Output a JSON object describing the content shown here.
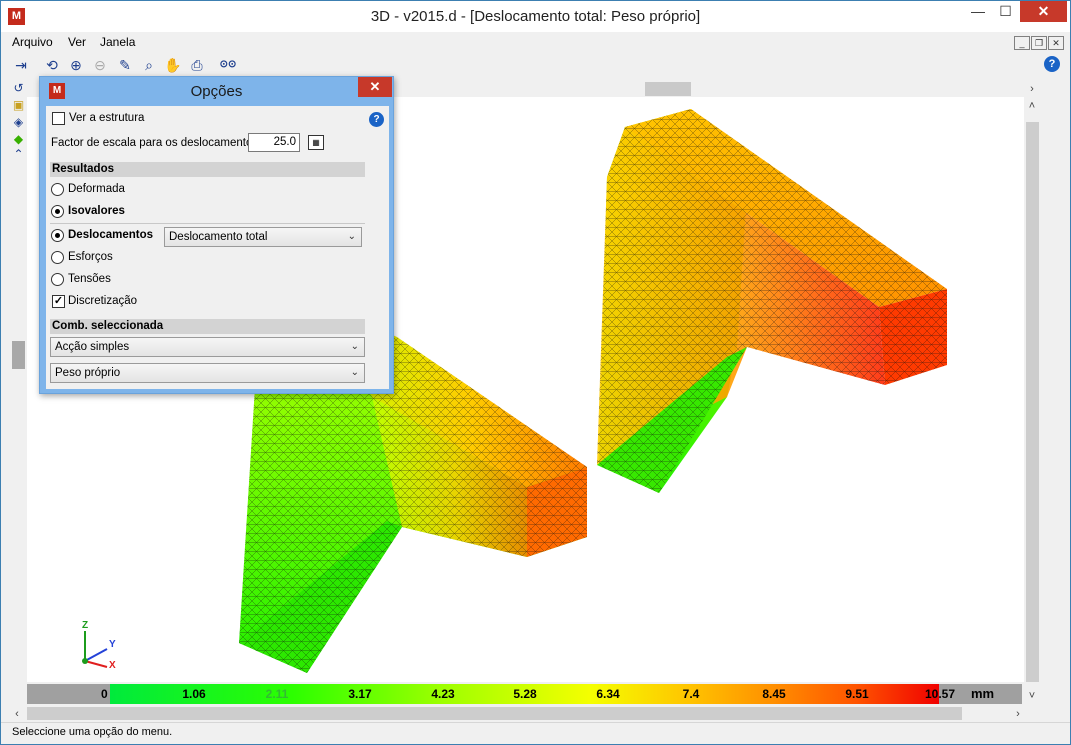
{
  "window": {
    "title": "3D - v2015.d - [Deslocamento total: Peso próprio]",
    "app_icon": "app-logo",
    "controls": {
      "minimize": "—",
      "maximize": "☐",
      "close": "✕"
    }
  },
  "menu": {
    "items": [
      {
        "label": "Arquivo"
      },
      {
        "label": "Ver"
      },
      {
        "label": "Janela"
      }
    ],
    "mdi_controls": {
      "minimize": "_",
      "restore": "❐",
      "close": "✕"
    }
  },
  "toolbar": {
    "buttons": [
      {
        "icon": "exit-icon",
        "glyph": "⇥"
      },
      {
        "icon": "rotate-view-icon",
        "glyph": "⟲"
      },
      {
        "icon": "zoom-window-icon",
        "glyph": "⊕"
      },
      {
        "icon": "zoom-out-icon",
        "glyph": "⊖"
      },
      {
        "icon": "pencil-icon",
        "glyph": "✎"
      },
      {
        "icon": "zoom-fit-icon",
        "glyph": "⌕"
      },
      {
        "icon": "pan-hand-icon",
        "glyph": "✋"
      },
      {
        "icon": "print-preview-icon",
        "glyph": "⎙"
      },
      {
        "icon": "binoculars-icon",
        "glyph": "⊙⊙"
      }
    ],
    "help_glyph": "?"
  },
  "left_tools": [
    {
      "icon": "rotate-icon",
      "glyph": "↺"
    },
    {
      "icon": "cube-icon",
      "glyph": "▣"
    },
    {
      "icon": "solid-icon",
      "glyph": "◈"
    },
    {
      "icon": "green-solid-icon",
      "glyph": "◆"
    },
    {
      "icon": "up-arrow-icon",
      "glyph": "⌃"
    }
  ],
  "dialog": {
    "title": "Opções",
    "close_glyph": "✕",
    "help_glyph": "?",
    "ver_estrutura": {
      "label": "Ver a estrutura",
      "checked": false
    },
    "scale_factor": {
      "label": "Factor de escala para os deslocamentos",
      "value": "25.0"
    },
    "resultados": {
      "header": "Resultados",
      "deformada": {
        "label": "Deformada",
        "selected": false
      },
      "isovalores": {
        "label": "Isovalores",
        "selected": true
      }
    },
    "tipo": {
      "deslocamentos": {
        "label": "Deslocamentos",
        "selected": true
      },
      "deslocamentos_select": "Deslocamento total",
      "esforcos": {
        "label": "Esforços",
        "selected": false
      },
      "tensoes": {
        "label": "Tensões",
        "selected": false
      },
      "discretizacao": {
        "label": "Discretização",
        "checked": true
      }
    },
    "comb": {
      "header": "Comb. seleccionada",
      "select1": "Acção simples",
      "select2": "Peso próprio"
    }
  },
  "legend": {
    "zero": "0",
    "values": [
      "1.06",
      "2.11",
      "3.17",
      "4.23",
      "5.28",
      "6.34",
      "7.4",
      "8.45",
      "9.51",
      "10.57"
    ],
    "unit": "mm",
    "colors": {
      "low": "#00ea3c",
      "mid": "#f5ff00",
      "high": "#f00000"
    }
  },
  "axes": {
    "z": "Z",
    "y": "Y",
    "x": "X"
  },
  "status": {
    "text": "Seleccione uma opção do menu."
  }
}
